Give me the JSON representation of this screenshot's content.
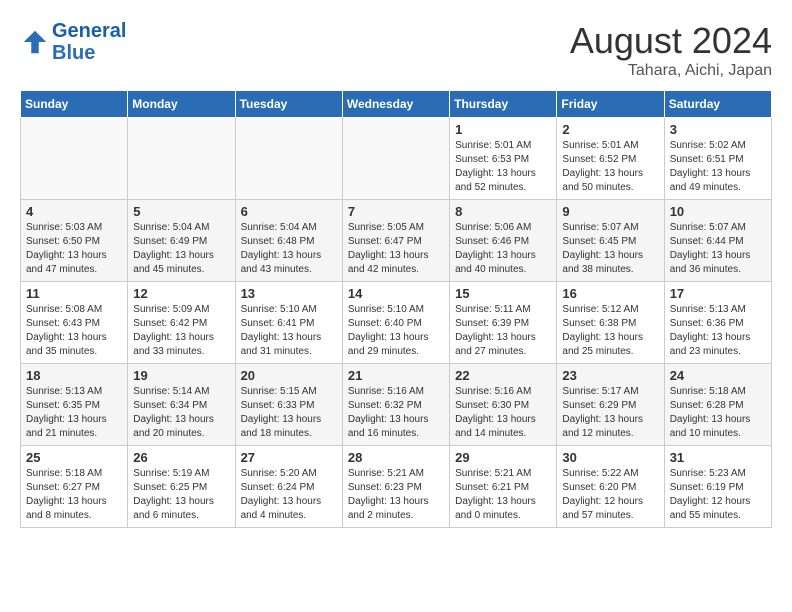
{
  "header": {
    "logo_line1": "General",
    "logo_line2": "Blue",
    "month": "August 2024",
    "location": "Tahara, Aichi, Japan"
  },
  "days_of_week": [
    "Sunday",
    "Monday",
    "Tuesday",
    "Wednesday",
    "Thursday",
    "Friday",
    "Saturday"
  ],
  "weeks": [
    [
      {
        "day": "",
        "text": ""
      },
      {
        "day": "",
        "text": ""
      },
      {
        "day": "",
        "text": ""
      },
      {
        "day": "",
        "text": ""
      },
      {
        "day": "1",
        "text": "Sunrise: 5:01 AM\nSunset: 6:53 PM\nDaylight: 13 hours and 52 minutes."
      },
      {
        "day": "2",
        "text": "Sunrise: 5:01 AM\nSunset: 6:52 PM\nDaylight: 13 hours and 50 minutes."
      },
      {
        "day": "3",
        "text": "Sunrise: 5:02 AM\nSunset: 6:51 PM\nDaylight: 13 hours and 49 minutes."
      }
    ],
    [
      {
        "day": "4",
        "text": "Sunrise: 5:03 AM\nSunset: 6:50 PM\nDaylight: 13 hours and 47 minutes."
      },
      {
        "day": "5",
        "text": "Sunrise: 5:04 AM\nSunset: 6:49 PM\nDaylight: 13 hours and 45 minutes."
      },
      {
        "day": "6",
        "text": "Sunrise: 5:04 AM\nSunset: 6:48 PM\nDaylight: 13 hours and 43 minutes."
      },
      {
        "day": "7",
        "text": "Sunrise: 5:05 AM\nSunset: 6:47 PM\nDaylight: 13 hours and 42 minutes."
      },
      {
        "day": "8",
        "text": "Sunrise: 5:06 AM\nSunset: 6:46 PM\nDaylight: 13 hours and 40 minutes."
      },
      {
        "day": "9",
        "text": "Sunrise: 5:07 AM\nSunset: 6:45 PM\nDaylight: 13 hours and 38 minutes."
      },
      {
        "day": "10",
        "text": "Sunrise: 5:07 AM\nSunset: 6:44 PM\nDaylight: 13 hours and 36 minutes."
      }
    ],
    [
      {
        "day": "11",
        "text": "Sunrise: 5:08 AM\nSunset: 6:43 PM\nDaylight: 13 hours and 35 minutes."
      },
      {
        "day": "12",
        "text": "Sunrise: 5:09 AM\nSunset: 6:42 PM\nDaylight: 13 hours and 33 minutes."
      },
      {
        "day": "13",
        "text": "Sunrise: 5:10 AM\nSunset: 6:41 PM\nDaylight: 13 hours and 31 minutes."
      },
      {
        "day": "14",
        "text": "Sunrise: 5:10 AM\nSunset: 6:40 PM\nDaylight: 13 hours and 29 minutes."
      },
      {
        "day": "15",
        "text": "Sunrise: 5:11 AM\nSunset: 6:39 PM\nDaylight: 13 hours and 27 minutes."
      },
      {
        "day": "16",
        "text": "Sunrise: 5:12 AM\nSunset: 6:38 PM\nDaylight: 13 hours and 25 minutes."
      },
      {
        "day": "17",
        "text": "Sunrise: 5:13 AM\nSunset: 6:36 PM\nDaylight: 13 hours and 23 minutes."
      }
    ],
    [
      {
        "day": "18",
        "text": "Sunrise: 5:13 AM\nSunset: 6:35 PM\nDaylight: 13 hours and 21 minutes."
      },
      {
        "day": "19",
        "text": "Sunrise: 5:14 AM\nSunset: 6:34 PM\nDaylight: 13 hours and 20 minutes."
      },
      {
        "day": "20",
        "text": "Sunrise: 5:15 AM\nSunset: 6:33 PM\nDaylight: 13 hours and 18 minutes."
      },
      {
        "day": "21",
        "text": "Sunrise: 5:16 AM\nSunset: 6:32 PM\nDaylight: 13 hours and 16 minutes."
      },
      {
        "day": "22",
        "text": "Sunrise: 5:16 AM\nSunset: 6:30 PM\nDaylight: 13 hours and 14 minutes."
      },
      {
        "day": "23",
        "text": "Sunrise: 5:17 AM\nSunset: 6:29 PM\nDaylight: 13 hours and 12 minutes."
      },
      {
        "day": "24",
        "text": "Sunrise: 5:18 AM\nSunset: 6:28 PM\nDaylight: 13 hours and 10 minutes."
      }
    ],
    [
      {
        "day": "25",
        "text": "Sunrise: 5:18 AM\nSunset: 6:27 PM\nDaylight: 13 hours and 8 minutes."
      },
      {
        "day": "26",
        "text": "Sunrise: 5:19 AM\nSunset: 6:25 PM\nDaylight: 13 hours and 6 minutes."
      },
      {
        "day": "27",
        "text": "Sunrise: 5:20 AM\nSunset: 6:24 PM\nDaylight: 13 hours and 4 minutes."
      },
      {
        "day": "28",
        "text": "Sunrise: 5:21 AM\nSunset: 6:23 PM\nDaylight: 13 hours and 2 minutes."
      },
      {
        "day": "29",
        "text": "Sunrise: 5:21 AM\nSunset: 6:21 PM\nDaylight: 13 hours and 0 minutes."
      },
      {
        "day": "30",
        "text": "Sunrise: 5:22 AM\nSunset: 6:20 PM\nDaylight: 12 hours and 57 minutes."
      },
      {
        "day": "31",
        "text": "Sunrise: 5:23 AM\nSunset: 6:19 PM\nDaylight: 12 hours and 55 minutes."
      }
    ]
  ]
}
